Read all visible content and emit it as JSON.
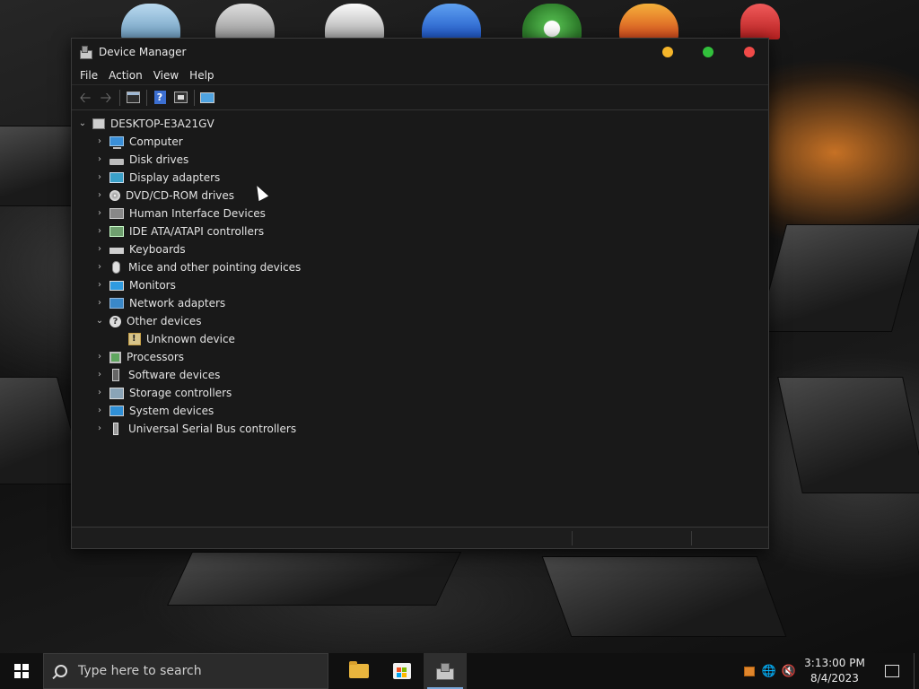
{
  "window": {
    "title": "Device Manager",
    "controls": {
      "minimize_color": "#f5b52a",
      "maximize_color": "#32c03c",
      "close_color": "#f04a48"
    }
  },
  "menu": [
    "File",
    "Action",
    "View",
    "Help"
  ],
  "toolbar": {
    "buttons": [
      "back-arrow-icon",
      "forward-arrow-icon",
      "properties-icon",
      "help-icon",
      "view-icon",
      "scan-monitor-icon"
    ]
  },
  "tree": {
    "root": "DESKTOP-E3A21GV",
    "categories": [
      {
        "label": "Computer",
        "icon": "computer-icon",
        "expanded": false
      },
      {
        "label": "Disk drives",
        "icon": "disk-drive-icon",
        "expanded": false
      },
      {
        "label": "Display adapters",
        "icon": "display-adapter-icon",
        "expanded": false
      },
      {
        "label": "DVD/CD-ROM drives",
        "icon": "dvd-icon",
        "expanded": false
      },
      {
        "label": "Human Interface Devices",
        "icon": "hid-icon",
        "expanded": false
      },
      {
        "label": "IDE ATA/ATAPI controllers",
        "icon": "ide-controller-icon",
        "expanded": false
      },
      {
        "label": "Keyboards",
        "icon": "keyboard-icon",
        "expanded": false
      },
      {
        "label": "Mice and other pointing devices",
        "icon": "mouse-icon",
        "expanded": false
      },
      {
        "label": "Monitors",
        "icon": "monitor-icon",
        "expanded": false
      },
      {
        "label": "Network adapters",
        "icon": "network-adapter-icon",
        "expanded": false
      },
      {
        "label": "Other devices",
        "icon": "other-devices-icon",
        "expanded": true
      },
      {
        "label": "Unknown device",
        "icon": "unknown-device-warning-icon",
        "child": true
      },
      {
        "label": "Processors",
        "icon": "processor-icon",
        "expanded": false
      },
      {
        "label": "Software devices",
        "icon": "software-device-icon",
        "expanded": false
      },
      {
        "label": "Storage controllers",
        "icon": "storage-controller-icon",
        "expanded": false
      },
      {
        "label": "System devices",
        "icon": "system-device-icon",
        "expanded": false
      },
      {
        "label": "Universal Serial Bus controllers",
        "icon": "usb-icon",
        "expanded": false
      }
    ]
  },
  "taskbar": {
    "search_placeholder": "Type here to search",
    "pinned": [
      "file-explorer-icon",
      "microsoft-store-icon",
      "device-manager-icon"
    ],
    "tray": [
      "store-tray-icon",
      "network-globe-icon",
      "volume-muted-icon"
    ],
    "time": "3:13:00 PM",
    "date": "8/4/2023"
  }
}
